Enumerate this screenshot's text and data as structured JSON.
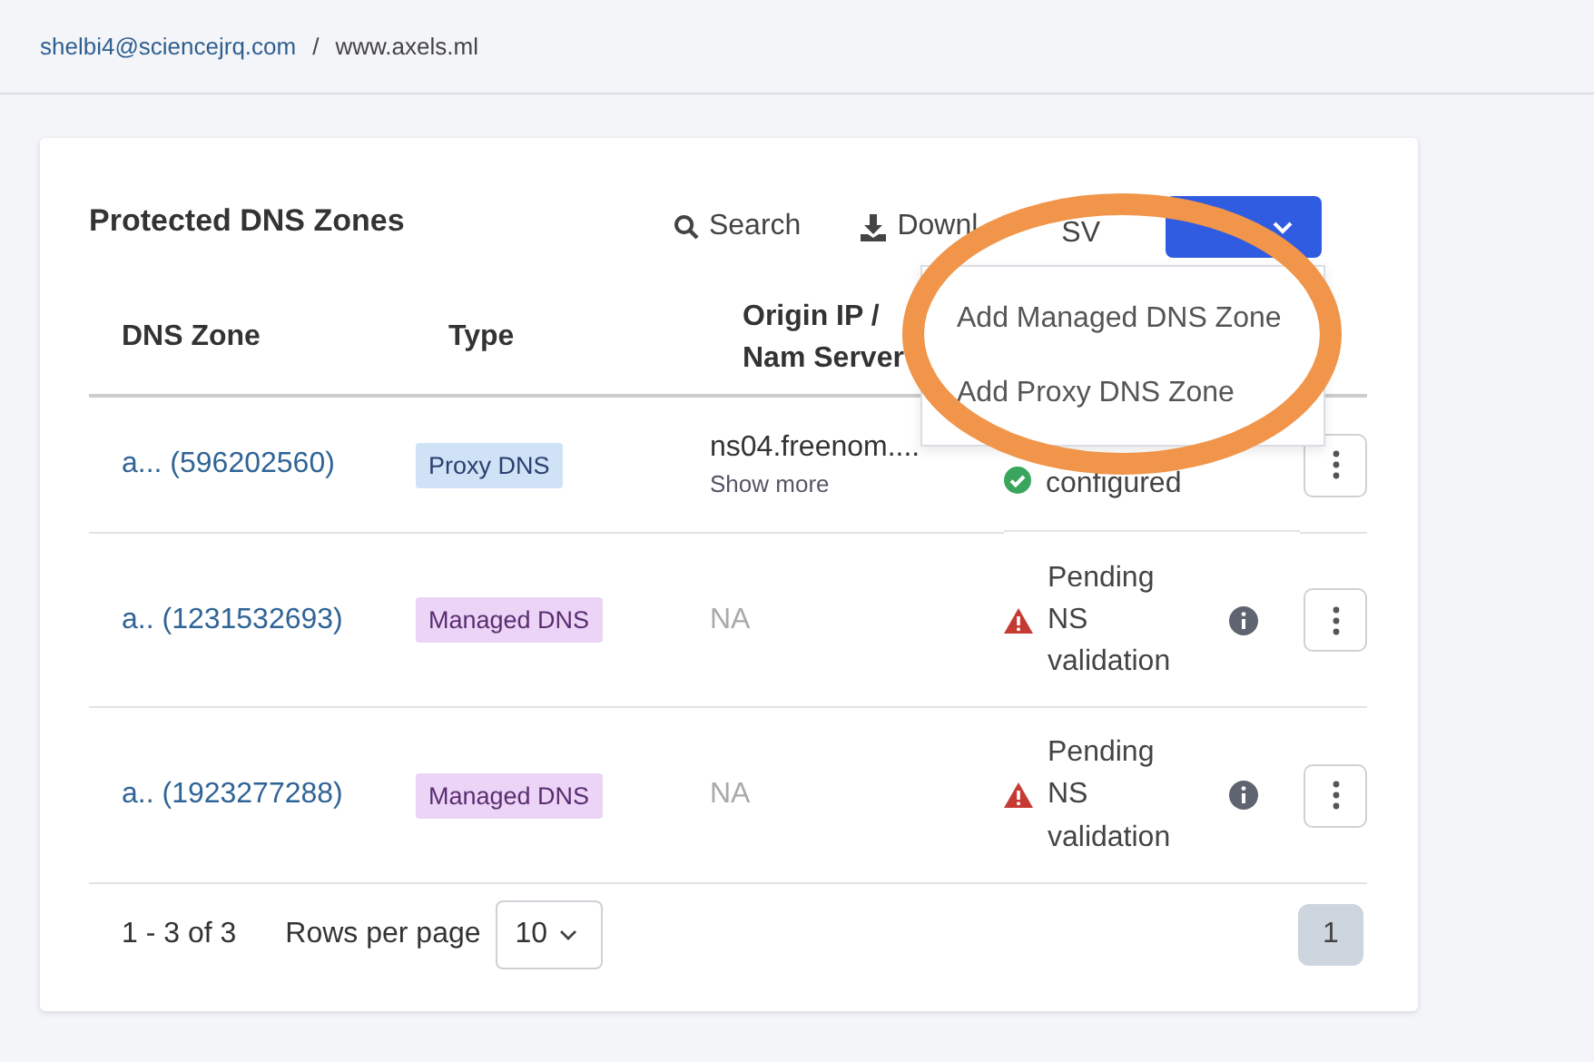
{
  "breadcrumb": [
    {
      "label": "shelbi4@sciencejrq.com",
      "link": true
    },
    {
      "label": "/",
      "link": false
    },
    {
      "label": "www.axels.ml",
      "link": false
    }
  ],
  "card": {
    "title": "Protected DNS Zones",
    "search_label": "Search",
    "download_label": [
      "Downl",
      "SV"
    ],
    "add_menu": {
      "expanded": true,
      "items": [
        "Add Managed DNS Zone",
        "Add Proxy DNS Zone"
      ]
    }
  },
  "table": {
    "columns": [
      "DNS Zone",
      "Type",
      "Origin IP / Nam Server"
    ],
    "rows": [
      {
        "zone": "a... (596202560)",
        "type": {
          "kind": "proxy",
          "label": "Proxy DNS"
        },
        "origin": "ns04.freenom....",
        "origin_muted": false,
        "show_more": "Show more",
        "status": {
          "kind": "ok",
          "label": "configured"
        },
        "info": false
      },
      {
        "zone": "a.. (1231532693)",
        "type": {
          "kind": "managed",
          "label": "Managed DNS"
        },
        "origin": "NA",
        "origin_muted": true,
        "status": {
          "kind": "warning",
          "label": "Pending NS validation"
        },
        "info": true
      },
      {
        "zone": "a.. (1923277288)",
        "type": {
          "kind": "managed",
          "label": "Managed DNS"
        },
        "origin": "NA",
        "origin_muted": true,
        "status": {
          "kind": "warning",
          "label": "Pending NS validation"
        },
        "info": true
      }
    ]
  },
  "footer": {
    "range": "1 - 3 of 3",
    "rows_per_page_label": "Rows per page",
    "rows_per_page": "10",
    "pages": [
      {
        "label": "1",
        "selected": true
      }
    ]
  },
  "annotation": {
    "kind": "ellipse",
    "color": "#f0954a"
  }
}
